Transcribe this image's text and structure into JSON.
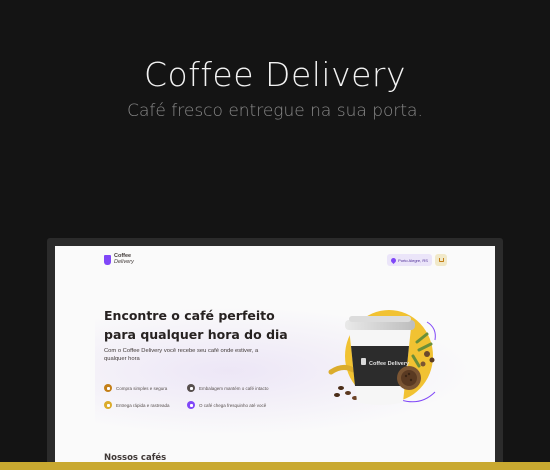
{
  "hero": {
    "title": "Coffee Delivery",
    "subtitle": "Café fresco entregue na sua porta."
  },
  "app": {
    "logo": {
      "line1": "Coffee",
      "line2": "Delivery"
    },
    "header": {
      "location": "Porto Alegre, RS",
      "cart_icon": "cart-icon",
      "location_icon": "map-pin-icon"
    },
    "intro": {
      "headline": "Encontre o café perfeito para qualquer hora do dia",
      "description": "Com o Coffee Delivery você recebe seu café onde estiver, a qualquer hora"
    },
    "features": [
      {
        "label": "Compra simples e segura",
        "color": "#c47f17",
        "icon": "cart-icon"
      },
      {
        "label": "Embalagem mantém o café intacto",
        "color": "#574f4d",
        "icon": "package-icon"
      },
      {
        "label": "Entrega rápida e rastreada",
        "color": "#dbac2c",
        "icon": "timer-icon"
      },
      {
        "label": "O café chega fresquinho até você",
        "color": "#8047f8",
        "icon": "coffee-icon"
      }
    ],
    "cup_label": "Coffee Delivery",
    "section_title": "Nossos cafés"
  },
  "colors": {
    "background": "#141414",
    "purple": "#8047f8",
    "yellow": "#dbac2c",
    "yellow_dark": "#c47f17"
  }
}
